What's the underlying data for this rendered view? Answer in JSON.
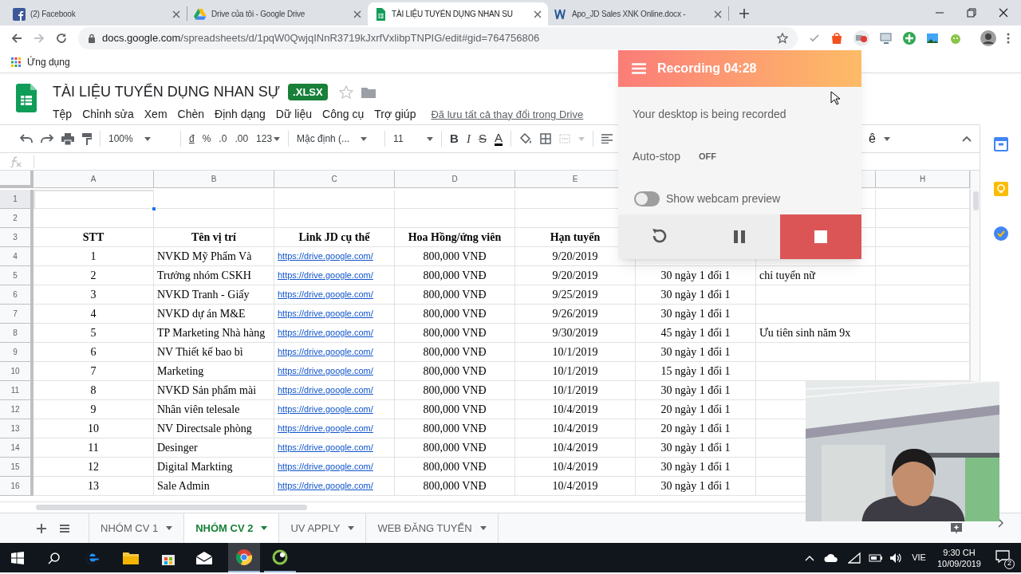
{
  "browser_tabs": [
    {
      "kind": "facebook",
      "title": "(2) Facebook",
      "selected": false
    },
    {
      "kind": "drive",
      "title": "Drive của tôi - Google Drive",
      "selected": false
    },
    {
      "kind": "sheets",
      "title": "TÀI LIỆU TUYỂN DỤNG NHAN SU",
      "selected": true
    },
    {
      "kind": "word",
      "title": "Apo_JD Sales XNK Online.docx -",
      "selected": false
    }
  ],
  "address_bar": {
    "host": "docs.google.com",
    "path": "/spreadsheets/d/1pqW0QwjqINnR3719kJxrfVxlibpTNPIG/edit#gid=764756806"
  },
  "bookmarks": [
    "Ứng dụng"
  ],
  "document": {
    "title": "TÀI LIỆU TUYỂN DỤNG NHAN SỰ",
    "badge": ".XLSX",
    "menu": [
      "Tệp",
      "Chỉnh sửa",
      "Xem",
      "Chèn",
      "Định dạng",
      "Dữ liệu",
      "Công cụ",
      "Trợ giúp"
    ],
    "save_status": "Đã lưu tất cả thay đổi trong Drive"
  },
  "toolbar": {
    "zoom": "100%",
    "formats": [
      "đ",
      "%",
      ".0",
      ".00",
      "123"
    ],
    "font": "Mặc định (...",
    "font_size": "11",
    "styles": [
      "B",
      "I",
      "S",
      "A"
    ],
    "more": "ê"
  },
  "columns": [
    {
      "label": "A",
      "kind": "center"
    },
    {
      "label": "B",
      "kind": "left"
    },
    {
      "label": "C",
      "kind": "link"
    },
    {
      "label": "D",
      "kind": "center"
    },
    {
      "label": "E",
      "kind": "center"
    },
    {
      "kind": "center"
    },
    {
      "kind": "left"
    },
    {
      "label": "H",
      "kind": "left"
    }
  ],
  "rows": [
    {
      "number": "1",
      "kind": "data",
      "selected": true
    },
    {
      "number": "2",
      "kind": "data",
      "selected": false
    },
    {
      "number": "3",
      "kind": "header",
      "selected": false,
      "cells": [
        "STT",
        "Tên vị trí",
        "Link JD cụ thể",
        "Hoa Hồng/ứng viên",
        "Hạn tuyển"
      ]
    },
    {
      "number": "4",
      "kind": "data",
      "selected": false,
      "cells": [
        "1",
        "NVKD Mỹ Phẩm Và",
        "https://drive.google.com/",
        "800,000 VNĐ",
        "9/20/2019"
      ]
    },
    {
      "number": "5",
      "kind": "data",
      "selected": false,
      "cells": [
        "2",
        "Trưởng nhóm CSKH",
        "https://drive.google.com/",
        "800,000 VNĐ",
        "9/20/2019",
        "30 ngày 1 đổi 1",
        "chỉ tuyển nữ"
      ]
    },
    {
      "number": "6",
      "kind": "data",
      "selected": false,
      "cells": [
        "3",
        "NVKD Tranh - Giấy",
        "https://drive.google.com/",
        "800,000 VNĐ",
        "9/25/2019",
        "30 ngày 1 đổi 1"
      ]
    },
    {
      "number": "7",
      "kind": "data",
      "selected": false,
      "cells": [
        "4",
        "NVKD dự án M&E",
        "https://drive.google.com/",
        "800,000 VNĐ",
        "9/26/2019",
        "30 ngày 1 đổi 1"
      ]
    },
    {
      "number": "8",
      "kind": "data",
      "selected": false,
      "cells": [
        "5",
        "TP Marketing Nhà hàng",
        "https://drive.google.com/",
        "800,000 VNĐ",
        "9/30/2019",
        "45 ngày 1 đổi 1",
        "Ưu tiên sinh năm 9x"
      ]
    },
    {
      "number": "9",
      "kind": "data",
      "selected": false,
      "cells": [
        "6",
        "NV Thiết kế bao bì",
        "https://drive.google.com/",
        "800,000 VNĐ",
        "10/1/2019",
        "30 ngày 1 đổi 1"
      ]
    },
    {
      "number": "10",
      "kind": "data",
      "selected": false,
      "cells": [
        "7",
        "Marketing",
        "https://drive.google.com/",
        "800,000 VNĐ",
        "10/1/2019",
        "15 ngày 1 đổi 1"
      ]
    },
    {
      "number": "11",
      "kind": "data",
      "selected": false,
      "cells": [
        "8",
        "NVKD Sản phẩm mài",
        "https://drive.google.com/",
        "800,000 VNĐ",
        "10/1/2019",
        "30 ngày 1 đổi 1"
      ]
    },
    {
      "number": "12",
      "kind": "data",
      "selected": false,
      "cells": [
        "9",
        "Nhân viên telesale",
        "https://drive.google.com/",
        "800,000 VNĐ",
        "10/4/2019",
        "20 ngày 1 đổi 1"
      ]
    },
    {
      "number": "13",
      "kind": "data",
      "selected": false,
      "cells": [
        "10",
        "NV Directsale phòng",
        "https://drive.google.com/",
        "800,000 VNĐ",
        "10/4/2019",
        "20 ngày 1 đổi 1"
      ]
    },
    {
      "number": "14",
      "kind": "data",
      "selected": false,
      "cells": [
        "11",
        "Desinger",
        "https://drive.google.com/",
        "800,000 VNĐ",
        "10/4/2019",
        "30 ngày 1 đổi 1"
      ]
    },
    {
      "number": "15",
      "kind": "data",
      "selected": false,
      "cells": [
        "12",
        "Digital Markting",
        "https://drive.google.com/",
        "800,000 VNĐ",
        "10/4/2019",
        "30 ngày 1 đổi 1"
      ]
    },
    {
      "number": "16",
      "kind": "data",
      "selected": false,
      "cells": [
        "13",
        "Sale Admin",
        "https://drive.google.com/",
        "800,000 VNĐ",
        "10/4/2019",
        "30 ngày 1 đổi 1"
      ]
    }
  ],
  "sheet_tabs": [
    {
      "label": "NHÓM CV 1",
      "selected": false
    },
    {
      "label": "NHÓM CV 2",
      "selected": true
    },
    {
      "label": "UV APPLY",
      "selected": false
    },
    {
      "label": "WEB ĐĂNG TUYỂN",
      "selected": false
    }
  ],
  "recorder": {
    "title": "Recording 04:28",
    "message": "Your desktop is being recorded",
    "auto_stop": {
      "label": "Auto-stop",
      "value": "OFF"
    },
    "webcam_preview": {
      "label": "Show webcam preview",
      "on": false
    }
  },
  "taskbar": {
    "language": "VIE",
    "time": "9:30 CH",
    "date": "10/09/2019",
    "notifications": "2"
  }
}
